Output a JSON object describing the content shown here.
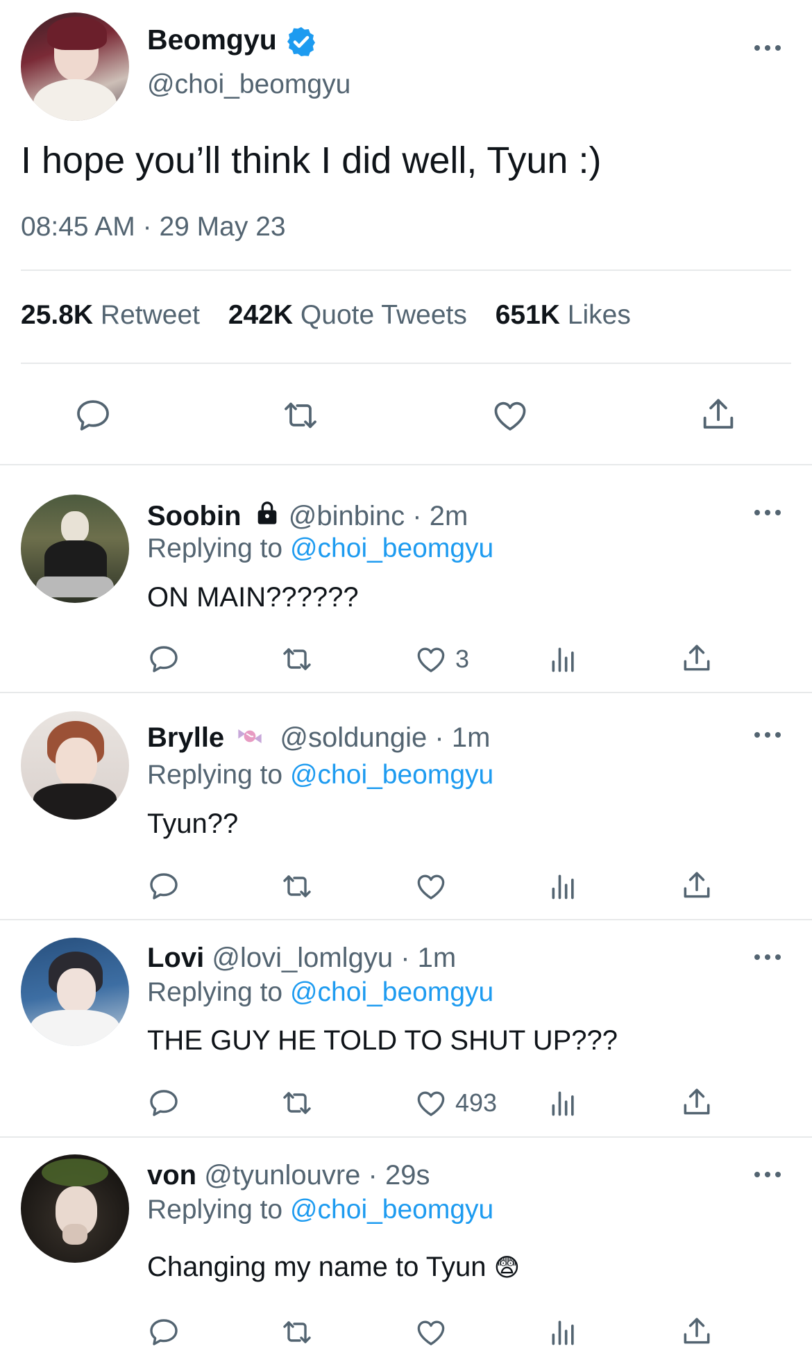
{
  "main_tweet": {
    "display_name": "Beomgyu",
    "verified": true,
    "handle": "@choi_beomgyu",
    "text": "I hope you’ll think I did well, Tyun :)",
    "time": "08:45 AM",
    "date_sep": "·",
    "date": "29 May 23",
    "stats": {
      "retweets_count": "25.8K",
      "retweets_label": "Retweet",
      "quotes_count": "242K",
      "quotes_label": "Quote Tweets",
      "likes_count": "651K",
      "likes_label": "Likes"
    }
  },
  "replies": [
    {
      "display_name": "Soobin",
      "badge_icon": "lock-icon",
      "handle": "@binbinc",
      "sep": "·",
      "time": "2m",
      "replying_prefix": "Replying to",
      "replying_to": "@choi_beomgyu",
      "text": "ON MAIN??????",
      "likes": "3"
    },
    {
      "display_name": "Brylle",
      "badge_icon": "candy-icon",
      "handle": "@soldungie",
      "sep": "·",
      "time": "1m",
      "replying_prefix": "Replying to",
      "replying_to": "@choi_beomgyu",
      "text": "Tyun??",
      "likes": ""
    },
    {
      "display_name": "Lovi",
      "handle": "@lovi_lomlgyu",
      "sep": "·",
      "time": "1m",
      "replying_prefix": "Replying to",
      "replying_to": "@choi_beomgyu",
      "text": "THE GUY HE TOLD TO SHUT UP???",
      "likes": "493"
    },
    {
      "display_name": "von",
      "handle": "@tyunlouvre",
      "sep": "·",
      "time": "29s",
      "replying_prefix": "Replying to",
      "replying_to": "@choi_beomgyu",
      "text": "Changing my name to Tyun",
      "emoji": "😨",
      "likes": ""
    }
  ],
  "colors": {
    "accent": "#1d9bf0",
    "text": "#0f1419",
    "muted": "#536471",
    "divider": "#e7e9ea"
  }
}
